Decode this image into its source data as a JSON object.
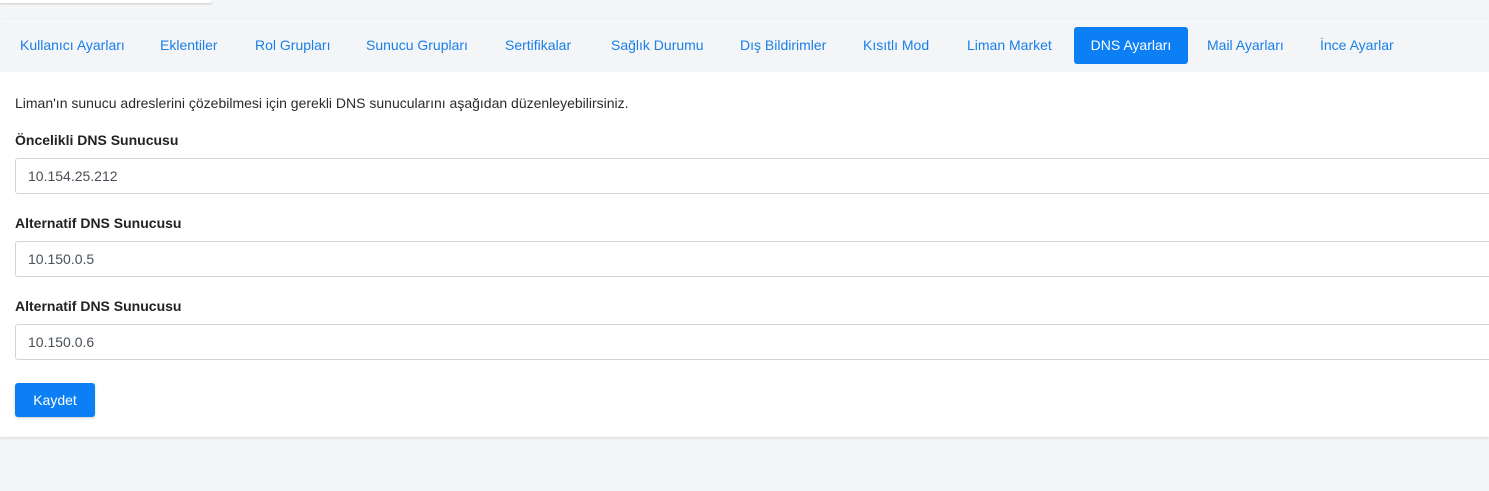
{
  "tabs": [
    {
      "label": "Kullanıcı Ayarları",
      "active": false
    },
    {
      "label": "Eklentiler",
      "active": false
    },
    {
      "label": "Rol Grupları",
      "active": false
    },
    {
      "label": "Sunucu Grupları",
      "active": false
    },
    {
      "label": "Sertifikalar",
      "active": false
    },
    {
      "label": "Sağlık Durumu",
      "active": false
    },
    {
      "label": "Dış Bildirimler",
      "active": false
    },
    {
      "label": "Kısıtlı Mod",
      "active": false
    },
    {
      "label": "Liman Market",
      "active": false
    },
    {
      "label": "DNS Ayarları",
      "active": true
    },
    {
      "label": "Mail Ayarları",
      "active": false
    },
    {
      "label": "İnce Ayarlar",
      "active": false
    }
  ],
  "dns": {
    "intro": "Liman'ın sunucu adreslerini çözebilmesi için gerekli DNS sunucularını aşağıdan düzenleyebilirsiniz.",
    "primary_label": "Öncelikli DNS Sunucusu",
    "primary_value": "10.154.25.212",
    "alt1_label": "Alternatif DNS Sunucusu",
    "alt1_value": "10.150.0.5",
    "alt2_label": "Alternatif DNS Sunucusu",
    "alt2_value": "10.150.0.6",
    "save_label": "Kaydet"
  },
  "colors": {
    "accent": "#0d7ff5",
    "link": "#1a7fe8",
    "page_bg": "#f4f5f7"
  }
}
